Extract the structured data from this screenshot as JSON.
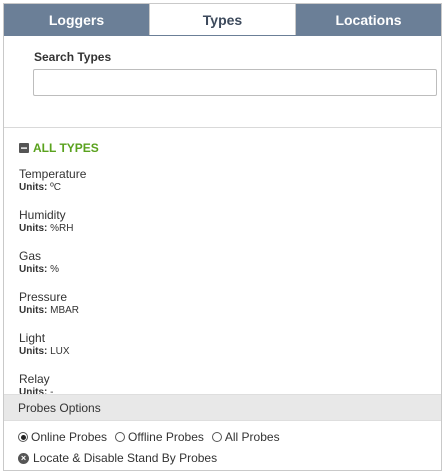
{
  "tabs": [
    {
      "label": "Loggers"
    },
    {
      "label": "Types"
    },
    {
      "label": "Locations"
    }
  ],
  "search": {
    "label": "Search Types",
    "placeholder": "",
    "value": ""
  },
  "all_types": {
    "label": "ALL TYPES",
    "icon": "collapse-icon"
  },
  "types": [
    {
      "name": "Temperature",
      "units_label": "Units:",
      "units": "ºC"
    },
    {
      "name": "Humidity",
      "units_label": "Units:",
      "units": "%RH"
    },
    {
      "name": "Gas",
      "units_label": "Units:",
      "units": "%"
    },
    {
      "name": "Pressure",
      "units_label": "Units:",
      "units": "MBAR"
    },
    {
      "name": "Light",
      "units_label": "Units:",
      "units": "LUX"
    },
    {
      "name": "Relay",
      "units_label": "Units:",
      "units": "-"
    }
  ],
  "probes_options": {
    "header": "Probes Options",
    "radios": [
      {
        "label": "Online Probes",
        "checked": true
      },
      {
        "label": "Offline Probes",
        "checked": false
      },
      {
        "label": "All Probes",
        "checked": false
      }
    ],
    "locate_label": "Locate & Disable Stand By Probes"
  },
  "colors": {
    "tab_bar": "#6b7f97",
    "all_types_green": "#5aa21e",
    "options_header_bg": "#e8e8e8"
  }
}
